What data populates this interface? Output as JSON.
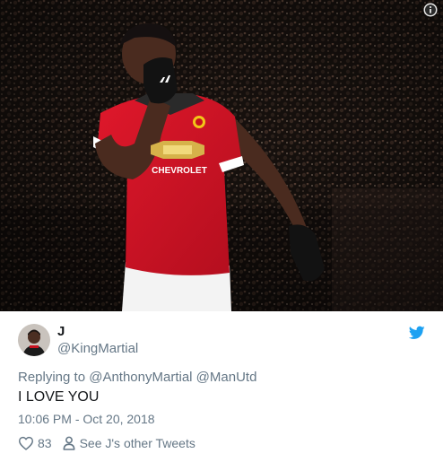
{
  "tweet": {
    "display_name": "J",
    "handle": "@KingMartial",
    "replying_prefix": "Replying to",
    "mentions": [
      "@AnthonyMartial",
      "@ManUtd"
    ],
    "text": "I LOVE YOU",
    "timestamp": "10:06 PM - Oct 20, 2018",
    "like_count": "83",
    "other_tweets_label": "See J's other Tweets"
  },
  "photo": {
    "sponsor_text": "CHEVROLET"
  },
  "icons": {
    "info": "info-icon",
    "brand": "twitter-bird-icon",
    "like": "heart-icon",
    "profile": "person-icon"
  },
  "colors": {
    "accent": "#1da1f2",
    "secondary_text": "#657786",
    "primary_text": "#14171a",
    "kit_red": "#d0021b"
  }
}
